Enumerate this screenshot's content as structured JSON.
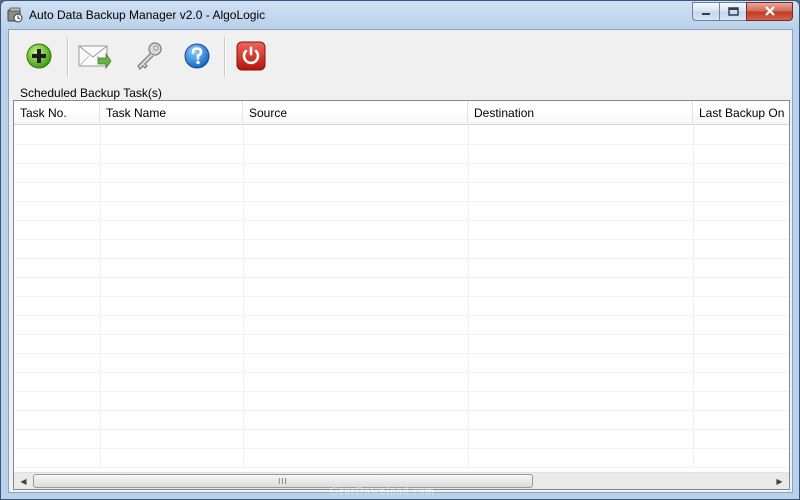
{
  "window": {
    "title": "Auto Data Backup Manager v2.0 - AlgoLogic",
    "icon": "backup-app-icon"
  },
  "caption_buttons": [
    {
      "name": "minimize",
      "icon": "minimize-icon"
    },
    {
      "name": "maximize",
      "icon": "maximize-icon"
    },
    {
      "name": "close",
      "icon": "close-icon"
    }
  ],
  "toolbar": {
    "buttons": [
      {
        "name": "add-task",
        "icon": "plus-circle-icon",
        "color": "#4caf1e"
      },
      {
        "name": "email",
        "icon": "envelope-arrow-icon",
        "color": "#6ab04c"
      },
      {
        "name": "register",
        "icon": "key-icon",
        "color": "#9a9a9a"
      },
      {
        "name": "help",
        "icon": "question-icon",
        "color": "#2b7bd6"
      },
      {
        "name": "exit",
        "icon": "power-icon",
        "color": "#d22a1e"
      }
    ]
  },
  "tasks_group": {
    "label": "Scheduled Backup Task(s)",
    "columns": [
      "Task No.",
      "Task Name",
      "Source",
      "Destination",
      "Last Backup On"
    ],
    "rows": []
  },
  "scrollbar": {
    "thumb_grip": "III"
  },
  "watermark": "GearDownload.com"
}
